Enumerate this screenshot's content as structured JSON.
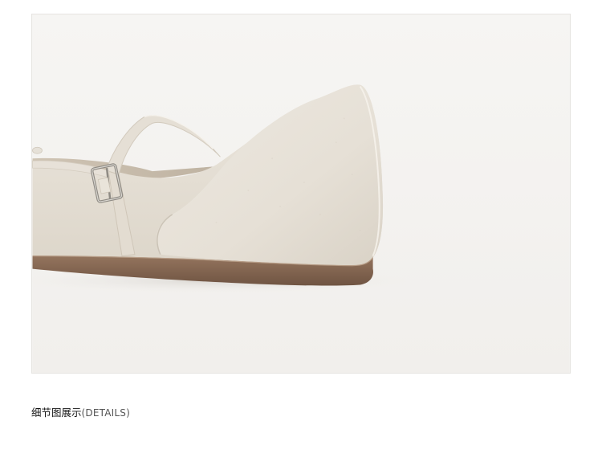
{
  "product_photo": {
    "subject": "shoe-heel-detail-photo",
    "colors": {
      "background": "#f4f3f1",
      "leather": "#e9e4db",
      "leather_shadow": "#d8d1c6",
      "sole": "#8a6a55",
      "buckle": "#b8b4ad"
    }
  },
  "caption": {
    "title_cn": "细节图展示",
    "title_en": "(DETAILS)"
  }
}
